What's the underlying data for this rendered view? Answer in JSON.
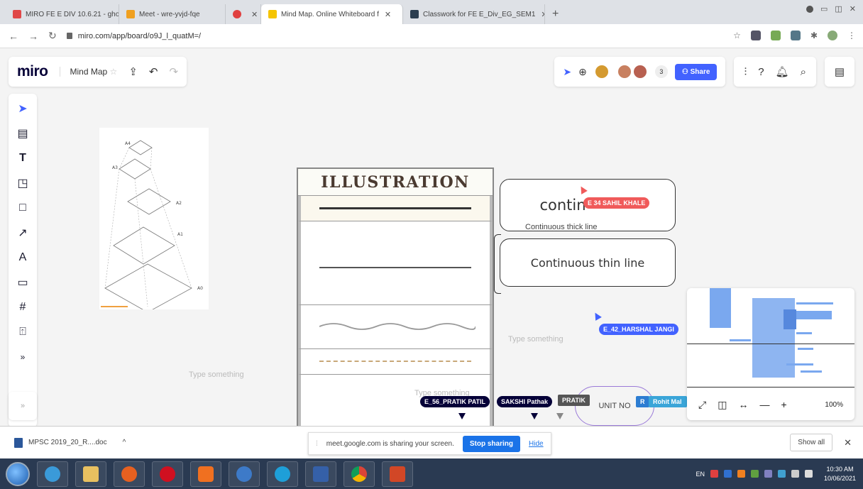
{
  "browser": {
    "tabs": [
      {
        "title": "MIRO FE E DIV 10.6.21 - ghogare",
        "fav_color": "#e04848",
        "active": false
      },
      {
        "title": "Meet - wre-yvjd-fqe",
        "fav_color": "#f0a020",
        "active": false
      },
      {
        "title": "",
        "fav_color": "#e04040",
        "active": false
      },
      {
        "title": "Mind Map. Online Whiteboard f",
        "fav_color": "#f5c400",
        "active": true
      },
      {
        "title": "Classwork for FE E_Div_EG_SEM1",
        "fav_color": "#2c3e50",
        "active": false
      }
    ],
    "new_tab_symbol": "+",
    "url": "miro.com/app/board/o9J_l_quatM=/"
  },
  "miro": {
    "logo": "miro",
    "board_name": "Mind Map",
    "share_label": "Share",
    "avatar_count": "3"
  },
  "board": {
    "illustration_title": "ILLUSTRATION",
    "box1_text": "contin",
    "box1_caption": "Continuous thick line",
    "box2_text": "Continuous thin line",
    "placeholder_right": "Type something",
    "placeholder_left": "Type something",
    "placeholder_bottom": "Type something",
    "unit_text": "UNIT NO",
    "drawing_labels": [
      "A4",
      "A3",
      "A2",
      "A1",
      "A0"
    ]
  },
  "cursors": [
    {
      "name": "E 34 SAHIL KHALE",
      "color": "#f05a5a"
    },
    {
      "name": "E_42_HARSHAL JANGI",
      "color": "#4262ff"
    },
    {
      "name": "E_56_PRATIK PATIL",
      "color": "#050038"
    },
    {
      "name": "SAKSHI Pathak",
      "color": "#050038"
    },
    {
      "name": "PRATIK",
      "color": "#555555"
    },
    {
      "name": "R",
      "color": "#2d7dd2"
    },
    {
      "name": "Rohit Mal",
      "color": "#3aa5d8"
    }
  ],
  "minimap": {
    "zoom": "100%"
  },
  "download": {
    "file": "MPSC 2019_20_R....doc"
  },
  "sharing_bar": {
    "message": "meet.google.com is sharing your screen.",
    "stop_label": "Stop sharing",
    "hide_label": "Hide"
  },
  "show_all": "Show all",
  "taskbar": {
    "lang": "EN",
    "time": "10:30 AM",
    "date": "10/06/2021"
  }
}
